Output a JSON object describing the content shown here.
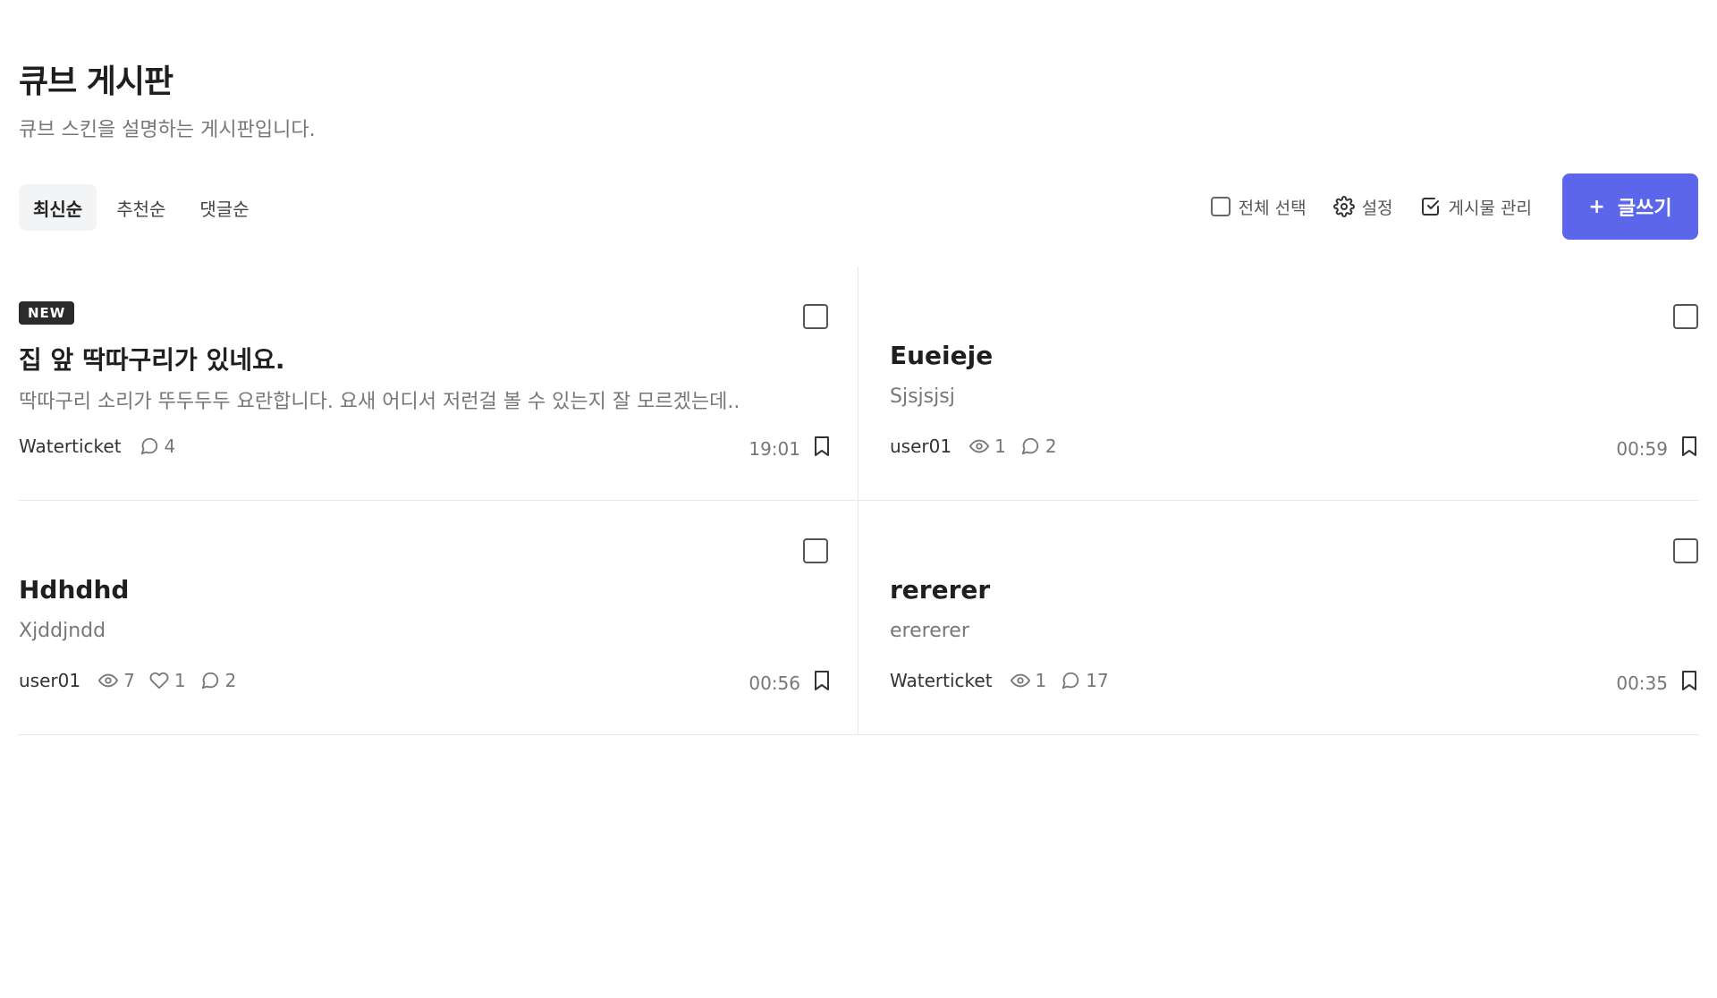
{
  "board": {
    "title": "큐브 게시판",
    "description": "큐브 스킨을 설명하는 게시판입니다."
  },
  "sort_tabs": [
    {
      "label": "최신순",
      "active": true
    },
    {
      "label": "추천순",
      "active": false
    },
    {
      "label": "댓글순",
      "active": false
    }
  ],
  "tools": {
    "select_all": "전체 선택",
    "settings": "설정",
    "manage": "게시물 관리",
    "write": "글쓰기",
    "write_plus": "+"
  },
  "posts": [
    {
      "badge": "NEW",
      "title": "집 앞 딱따구리가 있네요.",
      "excerpt": "딱따구리 소리가 뚜두두두 요란합니다. 요새 어디서 저런걸 볼 수 있는지 잘 모르겠는데..",
      "author": "Waterticket",
      "comments": "4",
      "time": "19:01"
    },
    {
      "title": "Eueieje",
      "excerpt": "Sjsjsjsj",
      "author": "user01",
      "views": "1",
      "comments": "2",
      "time": "00:59"
    },
    {
      "title": "Hdhdhd",
      "excerpt": "Xjddjndd",
      "author": "user01",
      "views": "7",
      "likes": "1",
      "comments": "2",
      "time": "00:56"
    },
    {
      "title": "rererer",
      "excerpt": "erererer",
      "author": "Waterticket",
      "views": "1",
      "comments": "17",
      "time": "00:35"
    }
  ],
  "colors": {
    "accent": "#5b66ea",
    "badge_bg": "#2b2b2b",
    "muted_text": "#777777"
  }
}
